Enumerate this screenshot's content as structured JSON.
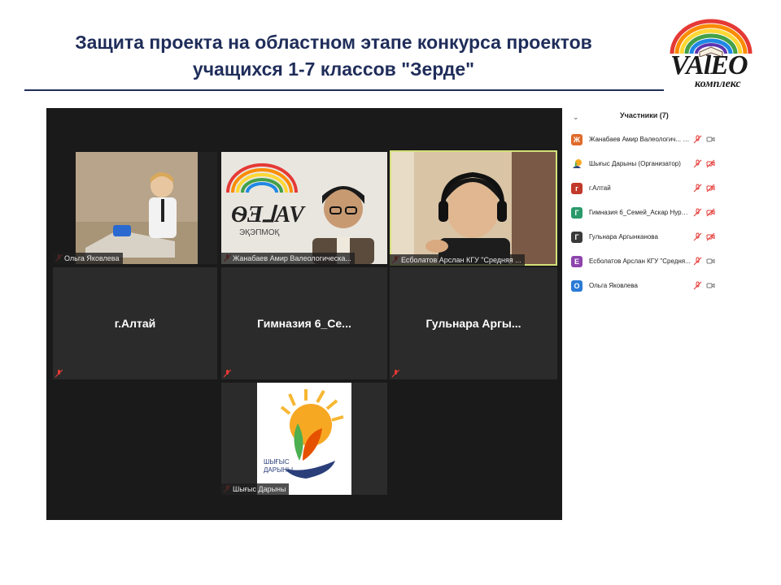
{
  "slide": {
    "title_line1": "Защита проекта на областном этапе конкурса проектов",
    "title_line2": "учащихся 1-7 классов \"Зерде\"",
    "logo_name": "VAlEO",
    "logo_sub": "комплекс"
  },
  "meeting": {
    "tiles": [
      {
        "name": "Ольга Яковлева",
        "type": "video"
      },
      {
        "name": "Жанабаев Амир Валеологическа...",
        "type": "video"
      },
      {
        "name": "Есболатов Арслан КГУ \"Средняя ...",
        "type": "video",
        "active": true
      },
      {
        "name": "г.Алтай",
        "type": "name"
      },
      {
        "name": "Гимназия 6_Се...",
        "type": "name"
      },
      {
        "name": "Гульнара Аргы...",
        "type": "name"
      },
      {
        "name": "Шығыс Дарыны",
        "type": "logo",
        "logo_text": "ШЫҒЫС\nДАРЫНЫ"
      }
    ],
    "shygys_logo_line1": "ШЫҒЫС",
    "shygys_logo_line2": "ДАРЫНЫ"
  },
  "participants": {
    "title": "Участники (7)",
    "items": [
      {
        "initial": "Ж",
        "color": "#e06a2a",
        "name": "Жанабаев Амир Валеологич... (Я)",
        "mic": "muted",
        "video": "on"
      },
      {
        "initial": "",
        "color": "#ffffff",
        "name": "Шығыс Дарыны (Организатор)",
        "mic": "muted",
        "video": "off"
      },
      {
        "initial": "г",
        "color": "#c0392b",
        "name": "г.Алтай",
        "mic": "muted",
        "video": "off"
      },
      {
        "initial": "Г",
        "color": "#2a9a6a",
        "name": "Гимназия 6_Семей_Аскар Нурис...",
        "mic": "muted",
        "video": "off"
      },
      {
        "initial": "Г",
        "color": "#3a3a3a",
        "name": "Гульнара Аргынканова",
        "mic": "muted",
        "video": "off"
      },
      {
        "initial": "Е",
        "color": "#8e44ad",
        "name": "Есболатов Арслан КГУ \"Средня...",
        "mic": "muted",
        "video": "on"
      },
      {
        "initial": "О",
        "color": "#2a7ad6",
        "name": "Ольга Яковлева",
        "mic": "muted",
        "video": "on"
      }
    ]
  }
}
